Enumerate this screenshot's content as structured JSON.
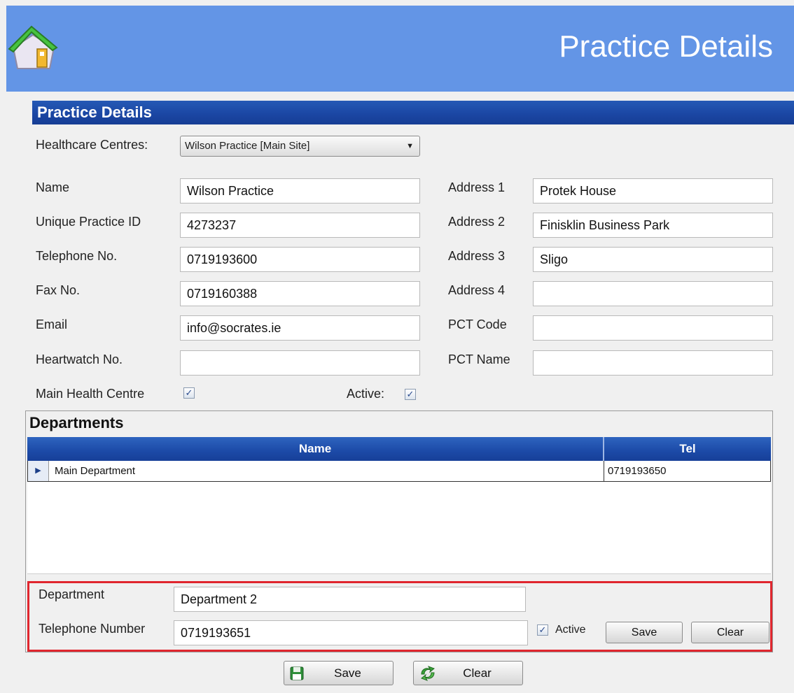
{
  "header": {
    "title": "Practice Details"
  },
  "section": {
    "title": "Practice Details"
  },
  "healthcare": {
    "label": "Healthcare Centres:",
    "selected": "Wilson Practice [Main Site]"
  },
  "fields_left": [
    {
      "label": "Name",
      "value": "Wilson Practice"
    },
    {
      "label": "Unique Practice ID",
      "value": "4273237"
    },
    {
      "label": "Telephone No.",
      "value": "0719193600"
    },
    {
      "label": "Fax No.",
      "value": "0719160388"
    },
    {
      "label": "Email",
      "value": "info@socrates.ie"
    },
    {
      "label": "Heartwatch No.",
      "value": ""
    }
  ],
  "fields_right": [
    {
      "label": "Address 1",
      "value": "Protek House"
    },
    {
      "label": "Address 2",
      "value": "Finisklin Business Park"
    },
    {
      "label": "Address 3",
      "value": "Sligo"
    },
    {
      "label": "Address 4",
      "value": ""
    },
    {
      "label": "PCT Code",
      "value": ""
    },
    {
      "label": "PCT Name",
      "value": ""
    }
  ],
  "main_health_centre": {
    "label": "Main Health Centre",
    "checked": true
  },
  "active": {
    "label": "Active:",
    "checked": true
  },
  "departments": {
    "title": "Departments",
    "columns": [
      "Name",
      "Tel"
    ],
    "rows": [
      {
        "name": "Main Department",
        "tel": "0719193650"
      }
    ],
    "editor": {
      "department_label": "Department",
      "department_value": "Department 2",
      "telephone_label": "Telephone Number",
      "telephone_value": "0719193651",
      "active_label": "Active",
      "active_checked": true,
      "save_label": "Save",
      "clear_label": "Clear"
    }
  },
  "footer": {
    "save_label": "Save",
    "clear_label": "Clear"
  },
  "colors": {
    "header": "#6395e6",
    "section_bar": "#1b47a4",
    "highlight_border": "#e0262e"
  },
  "icons": {
    "app": "house-icon",
    "save": "floppy-disk-icon",
    "clear": "eraser-arrows-icon"
  }
}
